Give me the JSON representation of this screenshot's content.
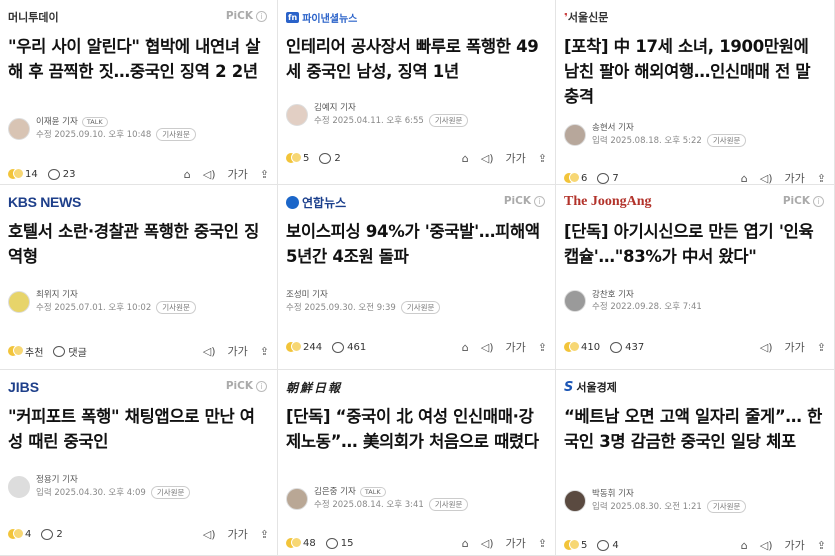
{
  "cards": [
    {
      "source": "머니투데이",
      "pick": "PiCK",
      "headline": "\"우리 사이 알린다\" 협박에 내연녀 살해 후 끔찍한 짓…중국인 징역 2 2년",
      "reporter": "이재윤 기자",
      "talk": "TALK",
      "date": "수정 2025.09.10. 오후 10:48",
      "original": "기사원문",
      "reaction1": "14",
      "reaction2": "23"
    },
    {
      "source": "파이낸셜뉴스",
      "source_badge": "fn",
      "pick": "",
      "headline": "인테리어 공사장서 빠루로 폭행한 49세 중국인 남성, 징역 1년",
      "reporter": "김예지 기자",
      "date": "수정 2025.04.11. 오후 6:55",
      "original": "기사원문",
      "reaction1": "5",
      "reaction2": "2"
    },
    {
      "source": "서울신문",
      "pick": "",
      "headline": "[포착] 中 17세 소녀, 1900만원에 남친 팔아 해외여행…인신매매 전 말 충격",
      "reporter": "송현서 기자",
      "date": "입력 2025.08.18. 오후 5:22",
      "original": "기사원문",
      "reaction1": "6",
      "reaction2": "7"
    },
    {
      "source": "KBS NEWS",
      "pick": "",
      "headline": "호텔서 소란·경찰관 폭행한 중국인 징역형",
      "reporter": "최위지 기자",
      "date": "수정 2025.07.01. 오후 10:02",
      "original": "기사원문",
      "reaction1": "추천",
      "reaction2": "댓글"
    },
    {
      "source": "연합뉴스",
      "pick": "PiCK",
      "headline": "보이스피싱 94%가 '중국발'…피해액 5년간 4조원 돌파",
      "reporter": "조성미 기자",
      "date": "수정 2025.09.30. 오전 9:39",
      "original": "기사원문",
      "reaction1": "244",
      "reaction2": "461"
    },
    {
      "source": "The JoongAng",
      "pick": "PiCK",
      "headline": "[단독] 아기시신으로 만든 엽기 '인육캡슐'…\"83%가 中서 왔다\"",
      "reporter": "강찬호 기자",
      "date": "수정 2022.09.28. 오후 7:41",
      "original": "",
      "reaction1": "410",
      "reaction2": "437"
    },
    {
      "source": "JIBS",
      "pick": "PiCK",
      "headline": "\"커피포트 폭행\" 채팅앱으로 만난 여성 때린 중국인",
      "reporter": "정용기 기자",
      "date": "입력 2025.04.30. 오후 4:09",
      "original": "기사원문",
      "reaction1": "4",
      "reaction2": "2"
    },
    {
      "source": "朝鮮日報",
      "pick": "",
      "headline": "[단독] “중국이 北 여성 인신매매·강제노동”… 美의회가 처음으로 때렸다",
      "reporter": "김은중 기자",
      "talk": "TALK",
      "date": "수정 2025.08.14. 오후 3:41",
      "original": "기사원문",
      "reaction1": "48",
      "reaction2": "15"
    },
    {
      "source": "서울경제",
      "pick": "",
      "headline": "“베트남 오면 고액 일자리 줄게”… 한국인 3명 감금한 중국인 일당 체포",
      "reporter": "박동휘 기자",
      "date": "입력 2025.08.30. 오전 1:21",
      "original": "기사원문",
      "reaction1": "5",
      "reaction2": "4"
    }
  ],
  "icons": {
    "listen": "speaker-icon",
    "font": "font-size-icon",
    "share": "share-icon",
    "bot": "summary-bot-icon"
  },
  "font_label": "가가",
  "accent": "#1e3f8a"
}
